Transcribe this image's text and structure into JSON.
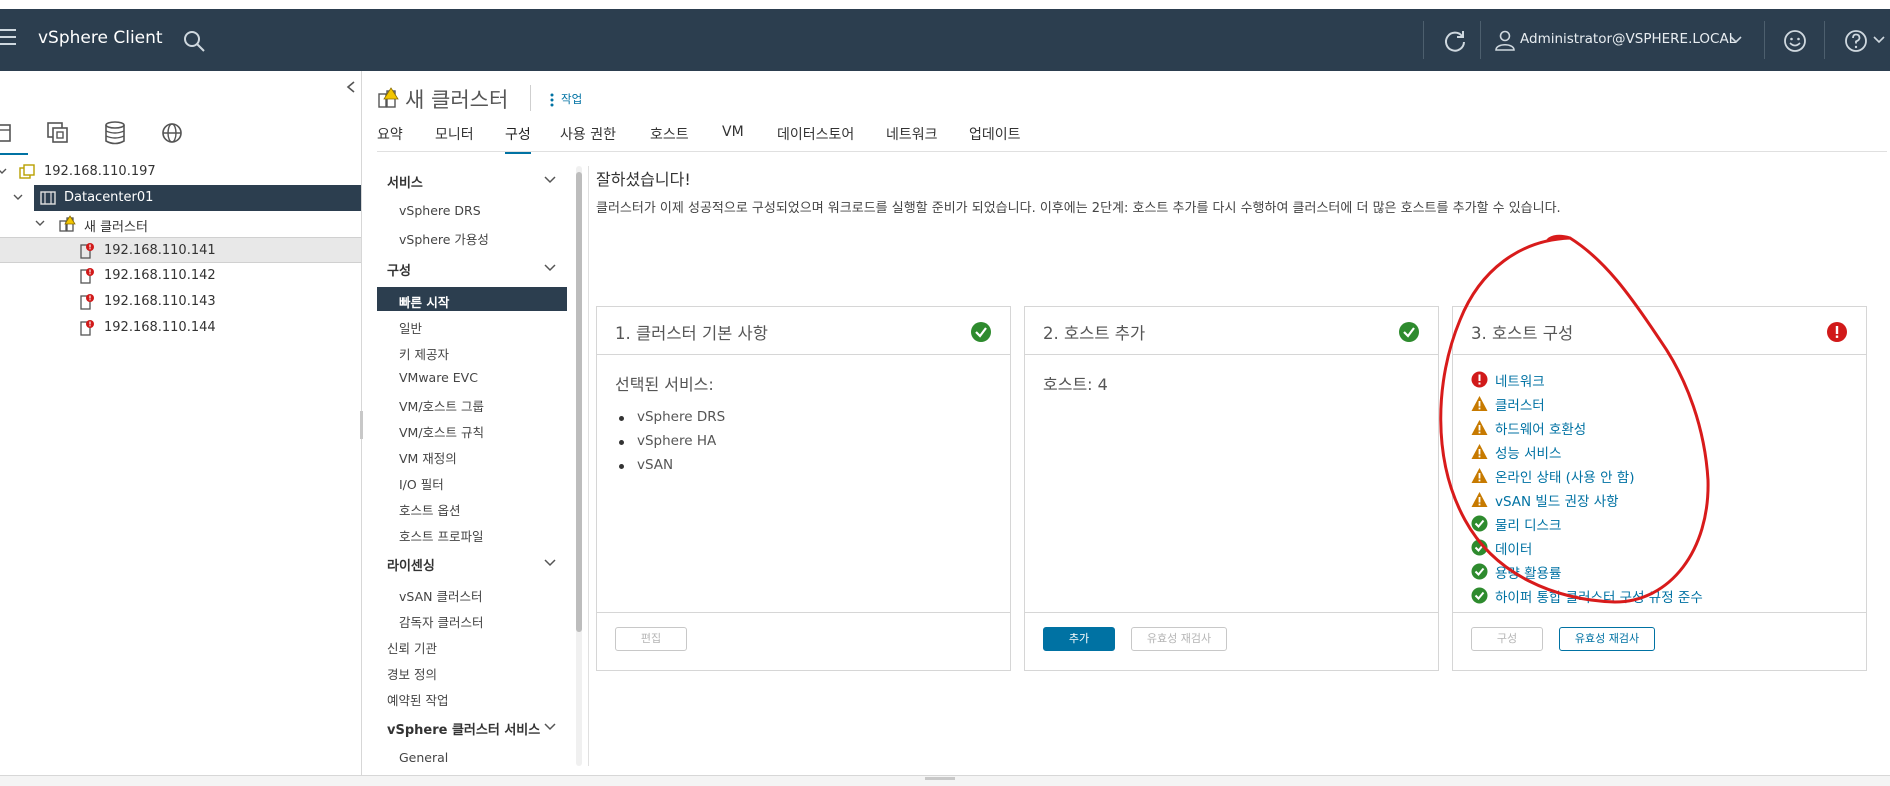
{
  "header": {
    "app_title": "vSphere Client",
    "user": "Administrator@VSPHERE.LOCAL",
    "icons": [
      "menu-icon",
      "search-icon",
      "refresh-icon",
      "user-icon",
      "feedback-smile-icon",
      "help-icon"
    ]
  },
  "navigator": {
    "tree": [
      {
        "label": "192.168.110.197",
        "type": "vcenter",
        "level": 0
      },
      {
        "label": "Datacenter01",
        "type": "datacenter",
        "level": 1,
        "selected": true
      },
      {
        "label": "새 클러스터",
        "type": "cluster",
        "level": 2
      },
      {
        "label": "192.168.110.141",
        "type": "host",
        "level": 3,
        "alert": true
      },
      {
        "label": "192.168.110.142",
        "type": "host",
        "level": 3,
        "alert": true
      },
      {
        "label": "192.168.110.143",
        "type": "host",
        "level": 3,
        "alert": true
      },
      {
        "label": "192.168.110.144",
        "type": "host",
        "level": 3,
        "alert": true
      }
    ]
  },
  "object": {
    "title": "새 클러스터",
    "actions": "작업"
  },
  "tabs": [
    "요약",
    "모니터",
    "구성",
    "사용 권한",
    "호스트",
    "VM",
    "데이터스토어",
    "네트워크",
    "업데이트"
  ],
  "active_tab": "구성",
  "side_menu": {
    "sections": [
      {
        "title": "서비스",
        "items": [
          "vSphere DRS",
          "vSphere 가용성"
        ]
      },
      {
        "title": "구성",
        "items": [
          "빠른 시작",
          "일반",
          "키 제공자",
          "VMware EVC",
          "VM/호스트 그룹",
          "VM/호스트 규칙",
          "VM 재정의",
          "I/O 필터",
          "호스트 옵션",
          "호스트 프로파일"
        ]
      },
      {
        "title": "라이센싱",
        "items": [
          "vSAN 클러스터",
          "감독자 클러스터"
        ]
      }
    ],
    "plain_items": [
      "신뢰 기관",
      "경보 정의",
      "예약된 작업"
    ],
    "last_section": {
      "title": "vSphere 클러스터 서비스",
      "items": [
        "General"
      ]
    },
    "active_item": "빠른 시작"
  },
  "content": {
    "congrats": "잘하셨습니다!",
    "description": "클러스터가 이제 성공적으로 구성되었으며 워크로드를 실행할 준비가 되었습니다. 이후에는 2단계: 호스트 추가를 다시 수행하여 클러스터에 더 많은 호스트를 추가할 수 있습니다.",
    "cards": [
      {
        "title": "1. 클러스터 기본 사항",
        "status": "success",
        "selected_services_label": "선택된 서비스:",
        "services": [
          "vSphere DRS",
          "vSphere HA",
          "vSAN"
        ],
        "buttons": [
          {
            "label": "편집",
            "state": "disabled"
          }
        ]
      },
      {
        "title": "2. 호스트 추가",
        "status": "success",
        "hosts_label": "호스트: 4",
        "buttons": [
          {
            "label": "추가",
            "state": "primary"
          },
          {
            "label": "유효성 재검사",
            "state": "disabled"
          }
        ]
      },
      {
        "title": "3. 호스트 구성",
        "status": "error",
        "checks": [
          {
            "label": "네트워크",
            "status": "error"
          },
          {
            "label": "클러스터",
            "status": "warning"
          },
          {
            "label": "하드웨어 호환성",
            "status": "warning"
          },
          {
            "label": "성능 서비스",
            "status": "warning"
          },
          {
            "label": "온라인 상태 (사용 안 함)",
            "status": "warning"
          },
          {
            "label": "vSAN 빌드 권장 사항",
            "status": "warning"
          },
          {
            "label": "물리 디스크",
            "status": "success"
          },
          {
            "label": "데이터",
            "status": "success"
          },
          {
            "label": "용량 활용률",
            "status": "success"
          },
          {
            "label": "하이퍼 통합 클러스터 구성 규정 준수",
            "status": "success"
          }
        ],
        "buttons": [
          {
            "label": "구성",
            "state": "disabled"
          },
          {
            "label": "유효성 재검사",
            "state": "outline"
          }
        ]
      }
    ]
  },
  "colors": {
    "header_bg": "#2c3e4f",
    "accent": "#0072a3",
    "success": "#2e8b2e",
    "warning": "#c77a00",
    "error": "#d11a1a",
    "annotation": "#d81b1b"
  }
}
